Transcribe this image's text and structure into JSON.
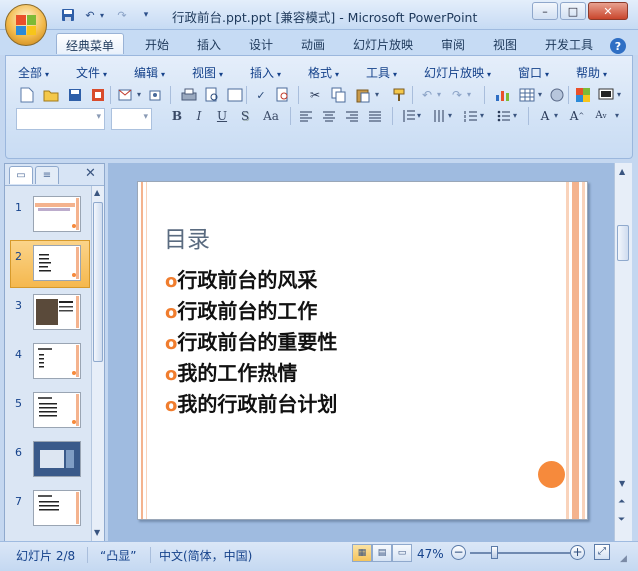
{
  "window": {
    "title": "行政前台.ppt.ppt [兼容模式] - Microsoft PowerPoint",
    "minimize_glyph": "–",
    "maximize_glyph": "□",
    "close_glyph": "✕"
  },
  "quick_access": {
    "items": [
      "save-icon",
      "undo-icon",
      "redo-icon",
      "customize-dropdown-icon"
    ]
  },
  "ribbon_tabs": [
    {
      "label": "经典菜单",
      "active": true
    },
    {
      "label": "开始"
    },
    {
      "label": "插入"
    },
    {
      "label": "设计"
    },
    {
      "label": "动画"
    },
    {
      "label": "幻灯片放映"
    },
    {
      "label": "审阅"
    },
    {
      "label": "视图"
    },
    {
      "label": "开发工具"
    }
  ],
  "classic_menu": [
    "全部",
    "文件",
    "编辑",
    "视图",
    "插入",
    "格式",
    "工具",
    "幻灯片放映",
    "窗口",
    "帮助"
  ],
  "format_buttons": [
    "B",
    "I",
    "U",
    "S",
    "Aa"
  ],
  "thumbnails": {
    "numbers": [
      "1",
      "2",
      "3",
      "4",
      "5",
      "6",
      "7"
    ],
    "selected_index": 2
  },
  "slide": {
    "title": "目录",
    "bullet_glyph": "o",
    "items": [
      "行政前台的风采",
      "行政前台的工作",
      "行政前台的重要性",
      "我的工作热情",
      "我的行政前台计划"
    ],
    "colors": {
      "accent": "#f68a3c",
      "title": "#5a6b80",
      "bullet": "#f07d2e",
      "stripe": "#f4b38e"
    }
  },
  "status_bar": {
    "slide_info": "幻灯片 2/8",
    "theme": "“凸显”",
    "language": "中文(简体，中国)",
    "zoom": "47%",
    "zoom_level": 0.47
  }
}
